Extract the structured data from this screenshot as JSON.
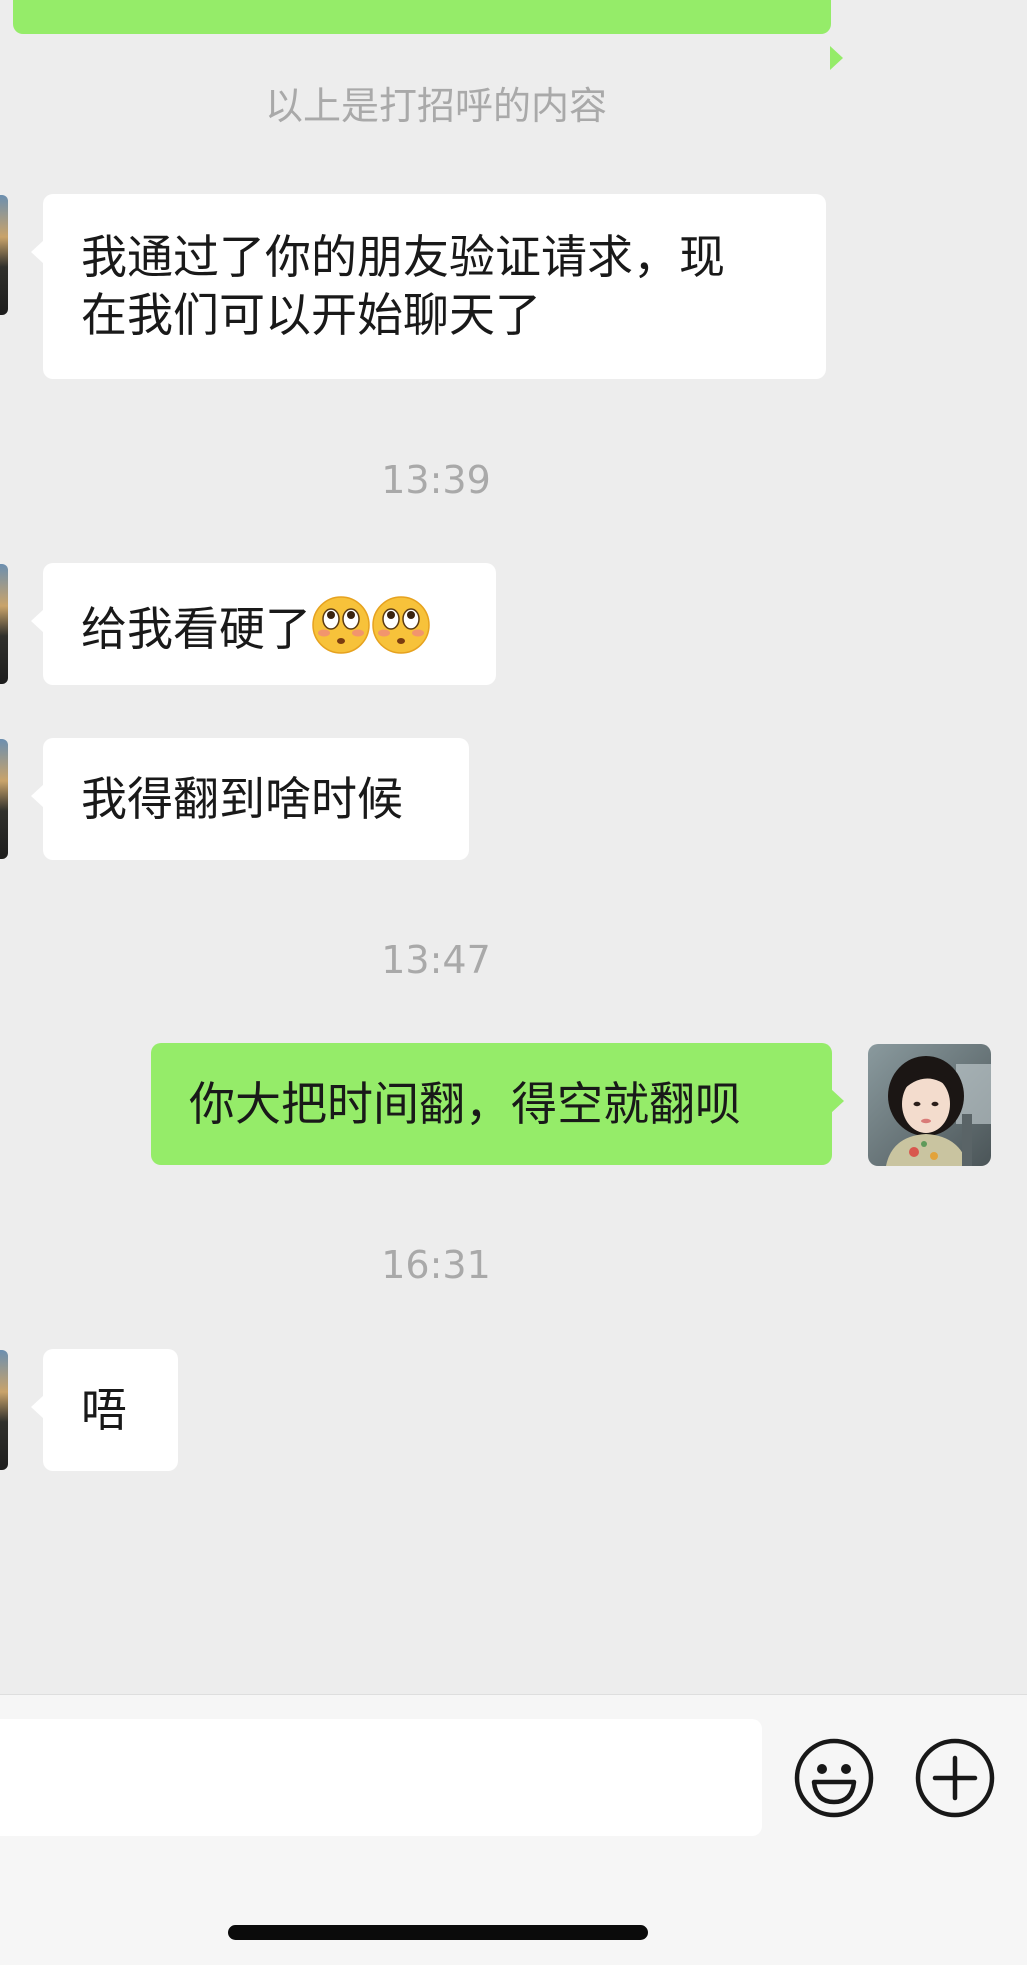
{
  "chat": {
    "greeting_notice": "以上是打招呼的内容",
    "messages": [
      {
        "side": "received",
        "text_lines": [
          "我通过了你的朋友验证请求，现",
          "在我们可以开始聊天了"
        ]
      },
      {
        "side": "time",
        "text": "13:39"
      },
      {
        "side": "received",
        "text": "给我看硬了",
        "emoji": [
          "flushed-face-emoji",
          "flushed-face-emoji"
        ]
      },
      {
        "side": "received",
        "text": "我得翻到啥时候"
      },
      {
        "side": "time",
        "text": "13:47"
      },
      {
        "side": "sent",
        "text": "你大把时间翻，得空就翻呗"
      },
      {
        "side": "time",
        "text": "16:31"
      },
      {
        "side": "received",
        "text": "唔"
      }
    ]
  },
  "input_bar": {
    "placeholder": "",
    "emoji_button_icon": "smiley-face-icon",
    "more_button_icon": "plus-circle-icon"
  },
  "colors": {
    "background": "#ededed",
    "sent_bubble": "#95ec69",
    "received_bubble": "#ffffff",
    "system_text": "#a9a9a9"
  }
}
